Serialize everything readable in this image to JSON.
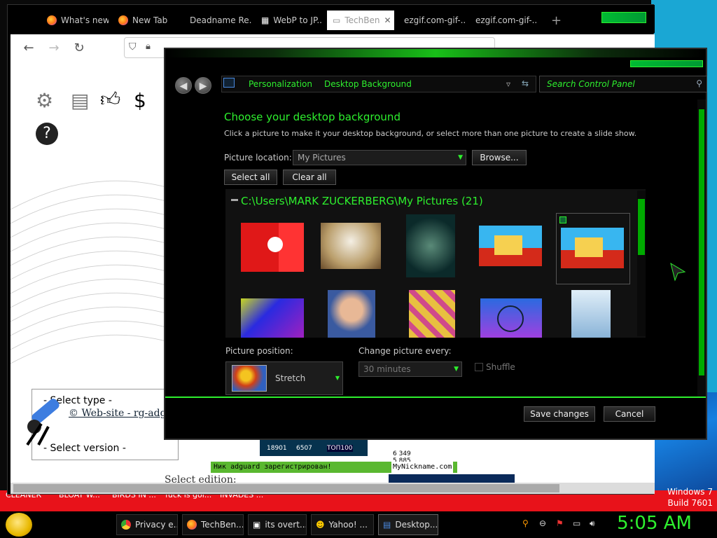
{
  "desktop": {
    "strip_texts": [
      "CLEANER",
      "BLOAT W...",
      "BIRDS IN ...",
      "fuck is goi...",
      "INVADES ..."
    ],
    "os_name": "Windows 7",
    "os_build": "Build 7601"
  },
  "browser": {
    "tabs": [
      {
        "label": "What's new",
        "active": false
      },
      {
        "label": "New Tab",
        "active": false
      },
      {
        "label": "Deadname Re...",
        "active": false
      },
      {
        "label": "WebP to JP...",
        "active": false
      },
      {
        "label": "TechBen",
        "active": true
      },
      {
        "label": "ezgif.com-gif-...",
        "active": false
      },
      {
        "label": "ezgif.com-gif-...",
        "active": false
      }
    ],
    "new_tab": "+",
    "page": {
      "select_type": "- Select type -",
      "website_link": "© Web-site - rg-adgu",
      "select_version": "- Select version -",
      "select_edition": "Select edition:"
    },
    "banner": {
      "num1": "18901",
      "num2": "6507",
      "top100": "ТОП100",
      "nick_msg": "Ник adguard зарегистрирован!",
      "nick_site": "MyNickname.com",
      "counter1": "6 349",
      "counter2": "5 885"
    }
  },
  "control_panel": {
    "breadcrumb": [
      "Personalization",
      "Desktop Background"
    ],
    "search_placeholder": "Search Control Panel",
    "heading": "Choose your desktop background",
    "description": "Click a picture to make it your desktop background, or select more than one picture to create a slide show.",
    "picture_location_label": "Picture location:",
    "picture_location_value": "My Pictures",
    "browse_label": "Browse...",
    "select_all_label": "Select all",
    "clear_all_label": "Clear all",
    "folder_path": "C:\\Users\\MARK ZUCKERBERG\\My Pictures (21)",
    "picture_position_label": "Picture position:",
    "picture_position_value": "Stretch",
    "change_every_label": "Change picture every:",
    "change_every_value": "30 minutes",
    "shuffle_label": "Shuffle",
    "save_label": "Save changes",
    "cancel_label": "Cancel"
  },
  "taskbar": {
    "tasks": [
      "Privacy e...",
      "TechBen...",
      "its overt...",
      "Yahoo! ...",
      "Desktop..."
    ],
    "clock": "5:05 AM"
  },
  "colors": {
    "accent": "#2ef02e",
    "bg": "#000000"
  }
}
